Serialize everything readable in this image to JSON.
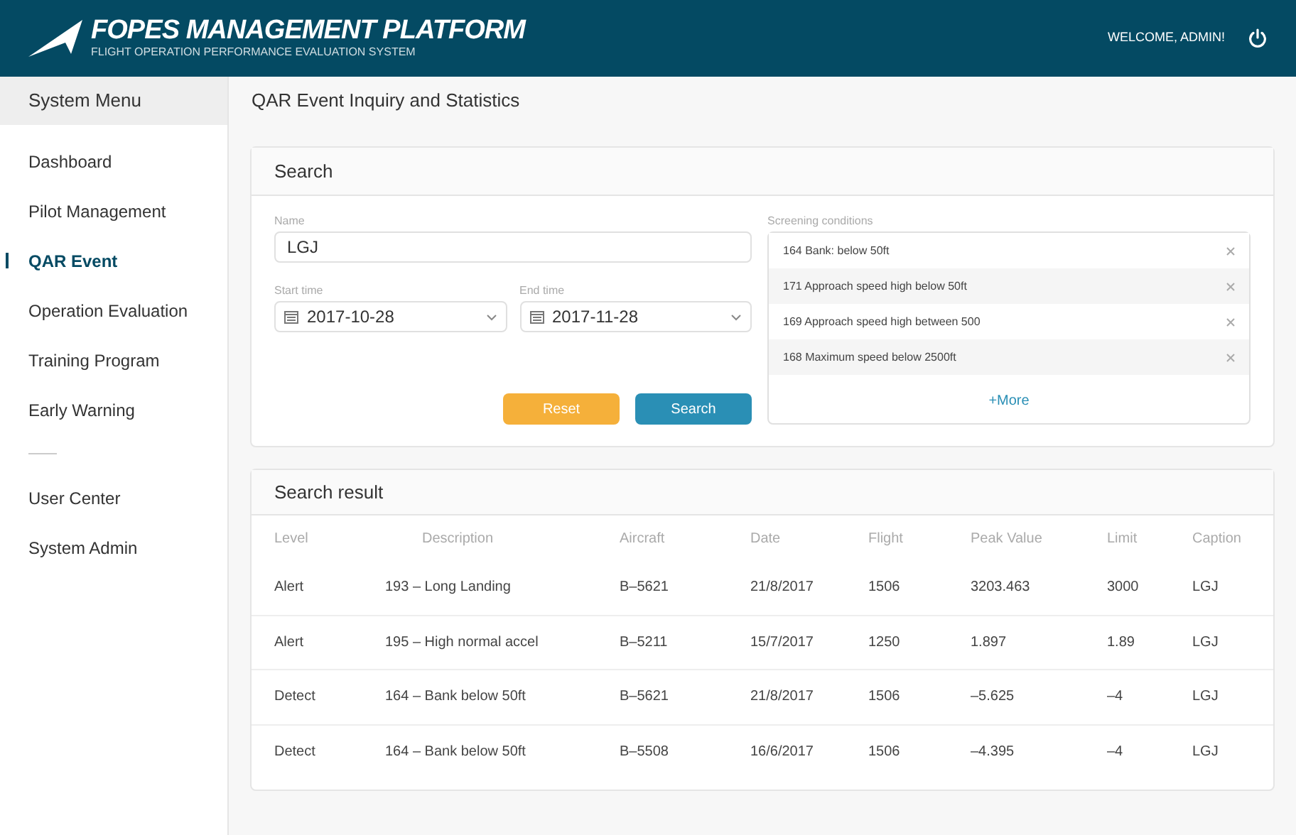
{
  "header": {
    "title": "FOPES MANAGEMENT PLATFORM",
    "subtitle": "FLIGHT OPERATION PERFORMANCE EVALUATION SYSTEM",
    "welcome": "WELCOME, ADMIN!"
  },
  "sidebar": {
    "title": "System Menu",
    "groups": [
      [
        {
          "label": "Dashboard",
          "selected": false
        },
        {
          "label": "Pilot Management",
          "selected": false
        },
        {
          "label": "QAR Event",
          "selected": true
        },
        {
          "label": "Operation Evaluation",
          "selected": false
        },
        {
          "label": "Training Program",
          "selected": false
        },
        {
          "label": "Early Warning",
          "selected": false
        }
      ],
      [
        {
          "label": "User Center",
          "selected": false
        },
        {
          "label": "System Admin",
          "selected": false
        }
      ]
    ]
  },
  "page_title": "QAR Event Inquiry and Statistics",
  "search": {
    "title": "Search",
    "name_label": "Name",
    "name_value": "LGJ",
    "start_label": "Start time",
    "start_value": "2017-10-28",
    "end_label": "End time",
    "end_value": "2017-11-28",
    "conditions_label": "Screening conditions",
    "conditions": [
      "164 Bank: below 50ft",
      "171 Approach speed high below 50ft",
      "169 Approach speed high between 500",
      "168 Maximum speed below 2500ft"
    ],
    "more": "+More",
    "buttons": [
      {
        "label": "Reset",
        "kind": "secondary"
      },
      {
        "label": "Search",
        "kind": "primary"
      }
    ]
  },
  "results": {
    "title": "Search result",
    "columns": [
      "Level",
      "Description",
      "Aircraft",
      "Date",
      "Flight",
      "Peak Value",
      "Limit",
      "Caption"
    ],
    "rows": [
      [
        "Alert",
        "193 – Long Landing",
        "B–5621",
        "21/8/2017",
        "1506",
        "3203.463",
        "3000",
        "LGJ"
      ],
      [
        "Alert",
        "195 – High normal accel",
        "B–5211",
        "15/7/2017",
        "1250",
        "1.897",
        "1.89",
        "LGJ"
      ],
      [
        "Detect",
        "164 – Bank below 50ft",
        "B–5621",
        "21/8/2017",
        "1506",
        "–5.625",
        "–4",
        "LGJ"
      ],
      [
        "Detect",
        "164 – Bank below 50ft",
        "B–5508",
        "16/6/2017",
        "1506",
        "–4.395",
        "–4",
        "LGJ"
      ]
    ]
  }
}
